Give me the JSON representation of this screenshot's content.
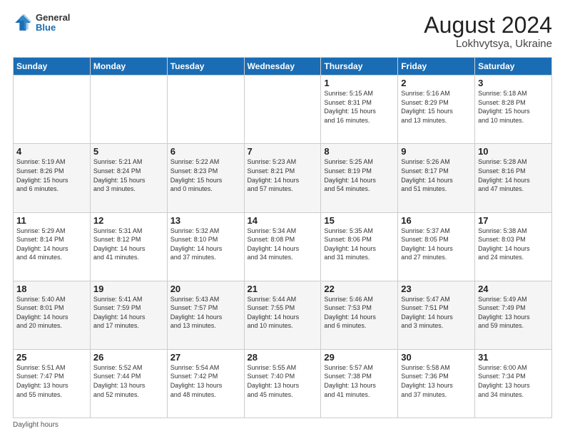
{
  "header": {
    "logo_general": "General",
    "logo_blue": "Blue",
    "month_year": "August 2024",
    "location": "Lokhvytsya, Ukraine"
  },
  "days_of_week": [
    "Sunday",
    "Monday",
    "Tuesday",
    "Wednesday",
    "Thursday",
    "Friday",
    "Saturday"
  ],
  "weeks": [
    [
      {
        "day": "",
        "info": ""
      },
      {
        "day": "",
        "info": ""
      },
      {
        "day": "",
        "info": ""
      },
      {
        "day": "",
        "info": ""
      },
      {
        "day": "1",
        "info": "Sunrise: 5:15 AM\nSunset: 8:31 PM\nDaylight: 15 hours\nand 16 minutes."
      },
      {
        "day": "2",
        "info": "Sunrise: 5:16 AM\nSunset: 8:29 PM\nDaylight: 15 hours\nand 13 minutes."
      },
      {
        "day": "3",
        "info": "Sunrise: 5:18 AM\nSunset: 8:28 PM\nDaylight: 15 hours\nand 10 minutes."
      }
    ],
    [
      {
        "day": "4",
        "info": "Sunrise: 5:19 AM\nSunset: 8:26 PM\nDaylight: 15 hours\nand 6 minutes."
      },
      {
        "day": "5",
        "info": "Sunrise: 5:21 AM\nSunset: 8:24 PM\nDaylight: 15 hours\nand 3 minutes."
      },
      {
        "day": "6",
        "info": "Sunrise: 5:22 AM\nSunset: 8:23 PM\nDaylight: 15 hours\nand 0 minutes."
      },
      {
        "day": "7",
        "info": "Sunrise: 5:23 AM\nSunset: 8:21 PM\nDaylight: 14 hours\nand 57 minutes."
      },
      {
        "day": "8",
        "info": "Sunrise: 5:25 AM\nSunset: 8:19 PM\nDaylight: 14 hours\nand 54 minutes."
      },
      {
        "day": "9",
        "info": "Sunrise: 5:26 AM\nSunset: 8:17 PM\nDaylight: 14 hours\nand 51 minutes."
      },
      {
        "day": "10",
        "info": "Sunrise: 5:28 AM\nSunset: 8:16 PM\nDaylight: 14 hours\nand 47 minutes."
      }
    ],
    [
      {
        "day": "11",
        "info": "Sunrise: 5:29 AM\nSunset: 8:14 PM\nDaylight: 14 hours\nand 44 minutes."
      },
      {
        "day": "12",
        "info": "Sunrise: 5:31 AM\nSunset: 8:12 PM\nDaylight: 14 hours\nand 41 minutes."
      },
      {
        "day": "13",
        "info": "Sunrise: 5:32 AM\nSunset: 8:10 PM\nDaylight: 14 hours\nand 37 minutes."
      },
      {
        "day": "14",
        "info": "Sunrise: 5:34 AM\nSunset: 8:08 PM\nDaylight: 14 hours\nand 34 minutes."
      },
      {
        "day": "15",
        "info": "Sunrise: 5:35 AM\nSunset: 8:06 PM\nDaylight: 14 hours\nand 31 minutes."
      },
      {
        "day": "16",
        "info": "Sunrise: 5:37 AM\nSunset: 8:05 PM\nDaylight: 14 hours\nand 27 minutes."
      },
      {
        "day": "17",
        "info": "Sunrise: 5:38 AM\nSunset: 8:03 PM\nDaylight: 14 hours\nand 24 minutes."
      }
    ],
    [
      {
        "day": "18",
        "info": "Sunrise: 5:40 AM\nSunset: 8:01 PM\nDaylight: 14 hours\nand 20 minutes."
      },
      {
        "day": "19",
        "info": "Sunrise: 5:41 AM\nSunset: 7:59 PM\nDaylight: 14 hours\nand 17 minutes."
      },
      {
        "day": "20",
        "info": "Sunrise: 5:43 AM\nSunset: 7:57 PM\nDaylight: 14 hours\nand 13 minutes."
      },
      {
        "day": "21",
        "info": "Sunrise: 5:44 AM\nSunset: 7:55 PM\nDaylight: 14 hours\nand 10 minutes."
      },
      {
        "day": "22",
        "info": "Sunrise: 5:46 AM\nSunset: 7:53 PM\nDaylight: 14 hours\nand 6 minutes."
      },
      {
        "day": "23",
        "info": "Sunrise: 5:47 AM\nSunset: 7:51 PM\nDaylight: 14 hours\nand 3 minutes."
      },
      {
        "day": "24",
        "info": "Sunrise: 5:49 AM\nSunset: 7:49 PM\nDaylight: 13 hours\nand 59 minutes."
      }
    ],
    [
      {
        "day": "25",
        "info": "Sunrise: 5:51 AM\nSunset: 7:47 PM\nDaylight: 13 hours\nand 55 minutes."
      },
      {
        "day": "26",
        "info": "Sunrise: 5:52 AM\nSunset: 7:44 PM\nDaylight: 13 hours\nand 52 minutes."
      },
      {
        "day": "27",
        "info": "Sunrise: 5:54 AM\nSunset: 7:42 PM\nDaylight: 13 hours\nand 48 minutes."
      },
      {
        "day": "28",
        "info": "Sunrise: 5:55 AM\nSunset: 7:40 PM\nDaylight: 13 hours\nand 45 minutes."
      },
      {
        "day": "29",
        "info": "Sunrise: 5:57 AM\nSunset: 7:38 PM\nDaylight: 13 hours\nand 41 minutes."
      },
      {
        "day": "30",
        "info": "Sunrise: 5:58 AM\nSunset: 7:36 PM\nDaylight: 13 hours\nand 37 minutes."
      },
      {
        "day": "31",
        "info": "Sunrise: 6:00 AM\nSunset: 7:34 PM\nDaylight: 13 hours\nand 34 minutes."
      }
    ]
  ],
  "footer": {
    "note": "Daylight hours"
  }
}
